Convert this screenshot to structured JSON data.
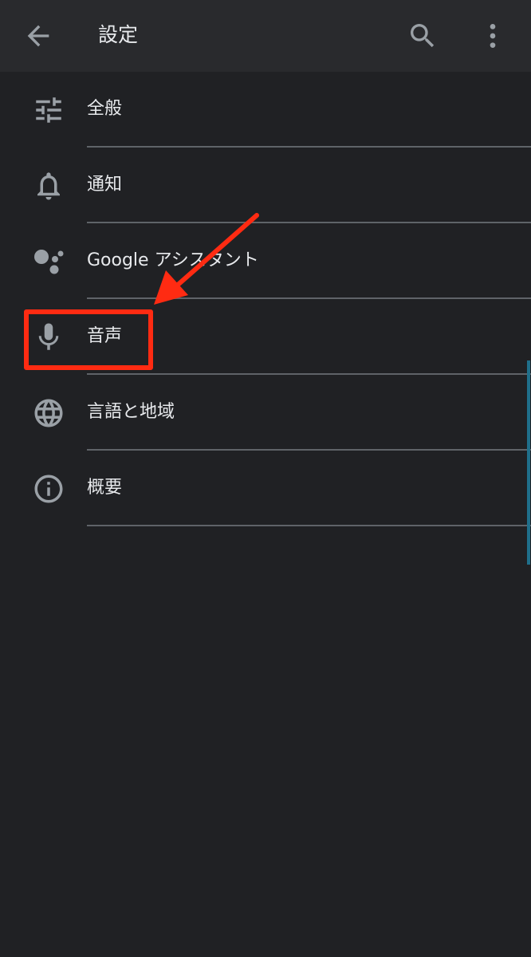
{
  "appbar": {
    "title": "設定",
    "back_icon": "arrow-back-icon",
    "search_icon": "search-icon",
    "more_icon": "more-vertical-icon"
  },
  "menu": {
    "items": [
      {
        "label": "全般",
        "icon": "tune-sliders-icon"
      },
      {
        "label": "通知",
        "icon": "bell-icon"
      },
      {
        "label": "Google アシスタント",
        "icon": "google-assistant-icon"
      },
      {
        "label": "音声",
        "icon": "microphone-icon"
      },
      {
        "label": "言語と地域",
        "icon": "globe-icon"
      },
      {
        "label": "概要",
        "icon": "info-icon"
      }
    ]
  },
  "colors": {
    "background": "#202124",
    "appbar": "#292a2d",
    "text": "#e8eaed",
    "icon": "#9aa0a6",
    "annotation": "#ff2b12"
  }
}
